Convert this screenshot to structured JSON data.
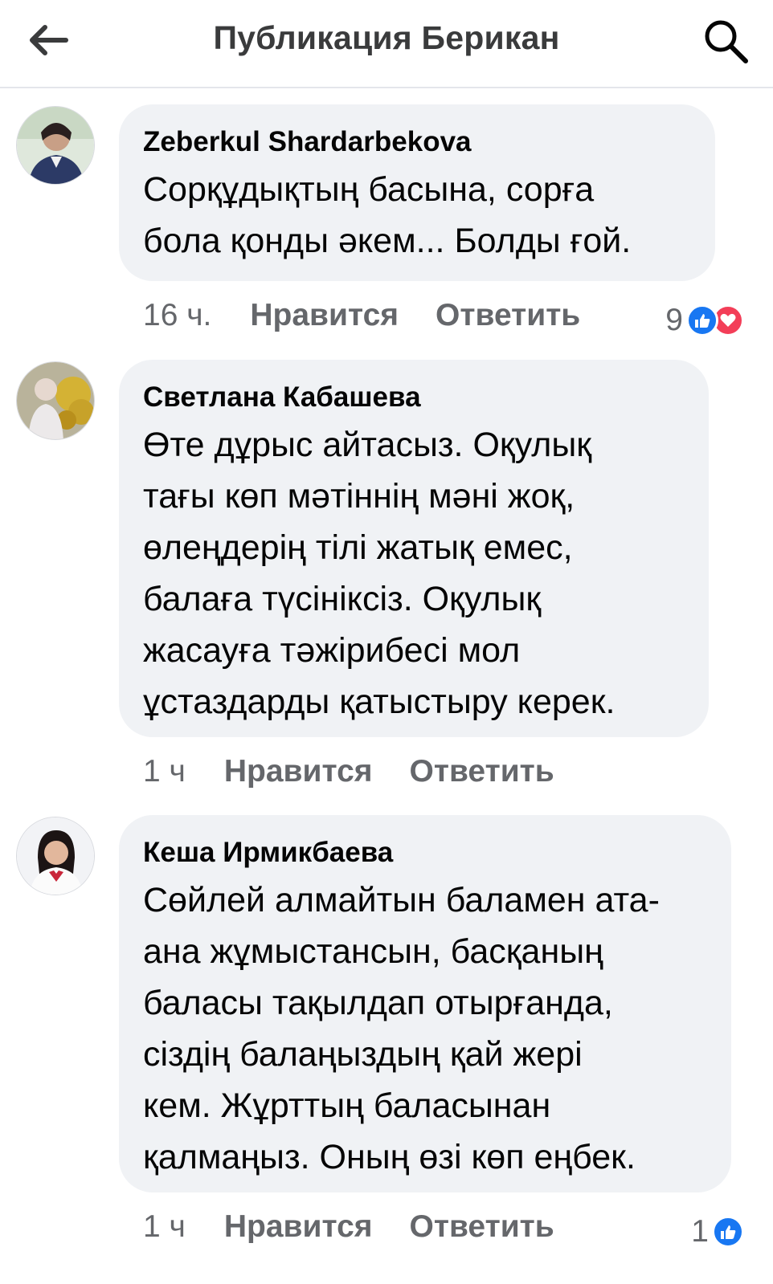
{
  "header": {
    "title": "Публикация Берикан"
  },
  "colors": {
    "bubble_bg": "#f0f2f5",
    "like_blue": "#1877f2",
    "love_red": "#f33e58",
    "meta_gray": "#65676b"
  },
  "comments": [
    {
      "author": "Zeberkul Shardarbekova",
      "text": "Сорқұдықтың басына, сорға\nбола қонды әкем... Болды ғой.",
      "time": "16 ч.",
      "like_label": "Нравится",
      "reply_label": "Ответить",
      "reaction_count": "9",
      "reactions": [
        "like-icon",
        "love-icon"
      ]
    },
    {
      "author": "Светлана Кабашева",
      "text": "Өте дұрыс айтасыз. Оқулық\nтағы көп мәтіннің мәні жоқ,\nөлеңдерің тілі жатық емес,\nбалаға түсініксіз. Оқулық\nжасауға тәжірибесі мол\nұстаздарды қатыстыру керек.",
      "time": "1 ч",
      "like_label": "Нравится",
      "reply_label": "Ответить"
    },
    {
      "author": "Кеша Ирмикбаева",
      "text": "Сөйлей алмайтын баламен ата-\nана жұмыстансын, басқаның\nбаласы тақылдап отырғанда,\nсіздің балаңыздың қай жері\nкем. Жұрттың баласынан\nқалмаңыз. Оның өзі көп еңбек.",
      "time": "1 ч",
      "like_label": "Нравится",
      "reply_label": "Ответить",
      "reaction_count": "1",
      "reactions": [
        "like-icon"
      ]
    }
  ]
}
